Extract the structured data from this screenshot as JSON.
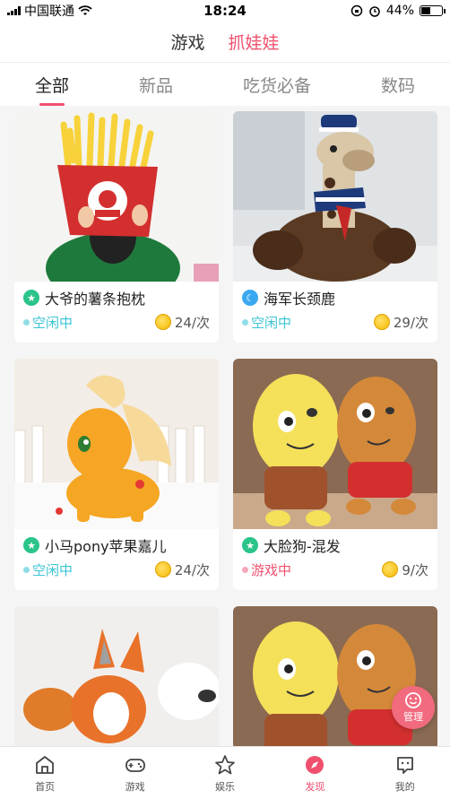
{
  "status_bar": {
    "carrier": "中国联通",
    "time": "18:24",
    "battery": "44%"
  },
  "top_nav": {
    "tabs": [
      "游戏",
      "抓娃娃"
    ],
    "active": 1
  },
  "categories": {
    "tabs": [
      "全部",
      "新品",
      "吃货必备",
      "数码"
    ],
    "active": 0
  },
  "cards": [
    {
      "name": "大爷的薯条抱枕",
      "badge": "star",
      "status": "空闲中",
      "status_type": "idle",
      "price": "24/次"
    },
    {
      "name": "海军长颈鹿",
      "badge": "moon",
      "status": "空闲中",
      "status_type": "idle",
      "price": "29/次"
    },
    {
      "name": "小马pony苹果嘉儿",
      "badge": "star",
      "status": "空闲中",
      "status_type": "idle",
      "price": "24/次"
    },
    {
      "name": "大脸狗-混发",
      "badge": "star",
      "status": "游戏中",
      "status_type": "playing",
      "price": "9/次"
    }
  ],
  "manage_button": {
    "label": "管理"
  },
  "tabbar": {
    "items": [
      {
        "label": "首页",
        "icon": "home-icon"
      },
      {
        "label": "游戏",
        "icon": "gamepad-icon"
      },
      {
        "label": "娱乐",
        "icon": "star-icon"
      },
      {
        "label": "发现",
        "icon": "compass-icon"
      },
      {
        "label": "我的",
        "icon": "profile-icon"
      }
    ],
    "active": 3
  },
  "colors": {
    "accent": "#f0506e",
    "idle": "#3bc4d4",
    "badge_green": "#2bc48a",
    "badge_blue": "#3aa8f0"
  }
}
